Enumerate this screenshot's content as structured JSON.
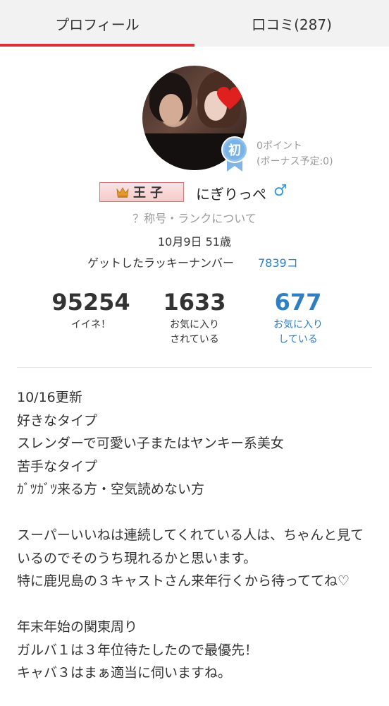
{
  "tabs": [
    {
      "label": "プロフィール",
      "active": true
    },
    {
      "label": "口コミ(287)",
      "active": false
    }
  ],
  "profile": {
    "points_line1": "0ポイント",
    "points_line2": "(ボーナス予定:0)",
    "badge_char": "初",
    "rank_label": "王子",
    "nickname": "にぎりっぺ",
    "gender_symbol": "♂",
    "title_link": "？称号・ランクについて",
    "birthday": "10月9日 51歳",
    "lucky_label": "ゲットしたラッキーナンバー",
    "lucky_count": "7839コ"
  },
  "stats": [
    {
      "value": "95254",
      "label": "イイネ！"
    },
    {
      "value": "1633",
      "label": "お気に入り\nされている"
    },
    {
      "value": "677",
      "label": "お気に入り\nしている"
    }
  ],
  "bio": "10/16更新\n好きなタイプ\nスレンダーで可愛い子またはヤンキー系美女\n苦手なタイプ\nｶﾞﾂｶﾞﾂ来る方・空気読めない方\n\nスーパーいいねは連続してくれている人は、ちゃんと見ているのでそのうち現れるかと思います。\n特に鹿児島の３キャストさん来年行くから待っててね♡\n\n年末年始の関東周り\nガルバ１は３年位待たしたので最優先！\nキャバ３はまぁ適当に伺いますね。",
  "colors": {
    "accent_red": "#d93038",
    "link_blue": "#2f7fc1",
    "muted_gray": "#999999"
  }
}
